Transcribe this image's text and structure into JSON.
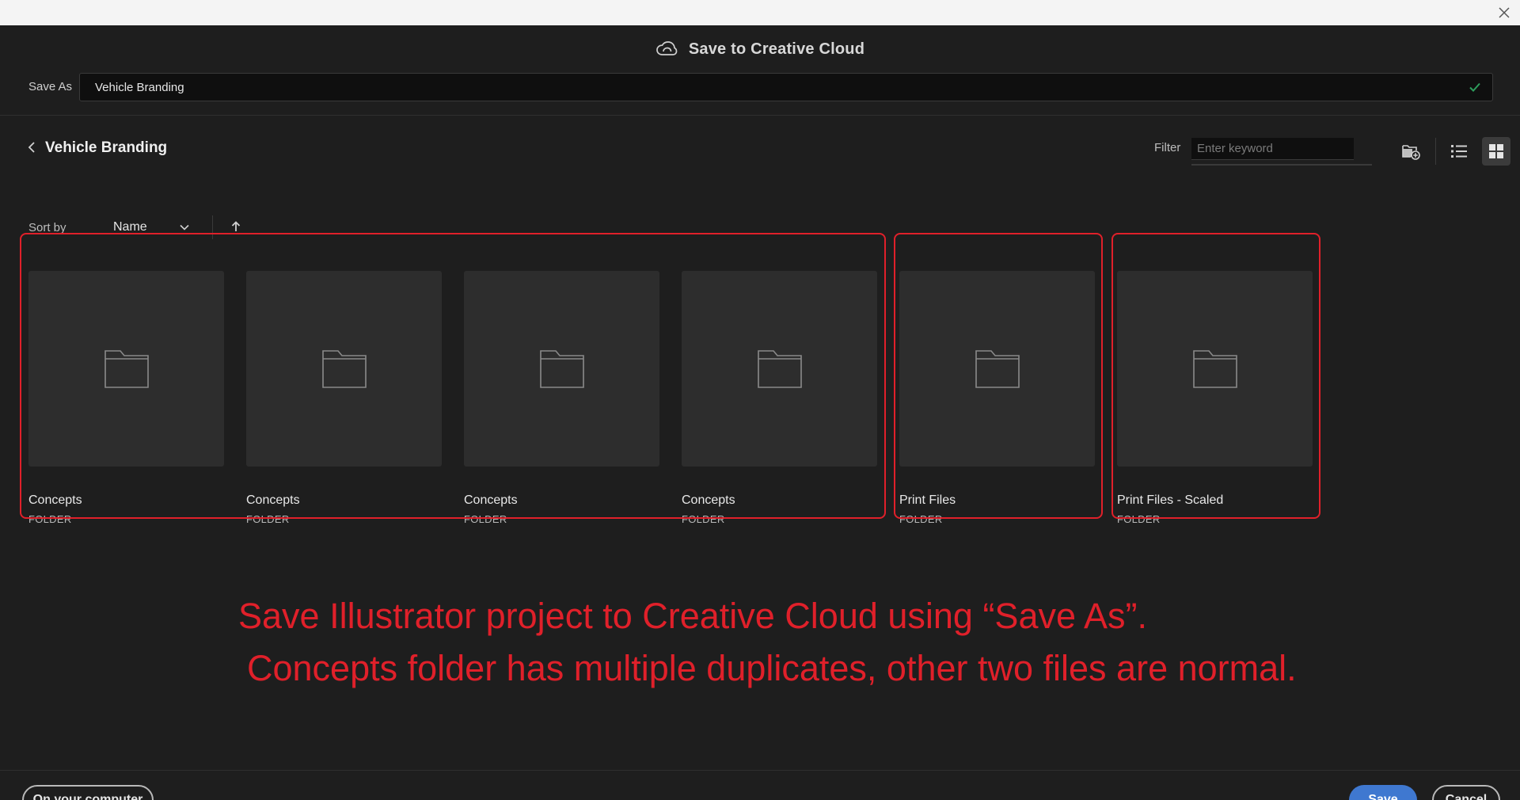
{
  "window": {
    "close_icon": "close-icon"
  },
  "dialog": {
    "title": "Save to Creative Cloud",
    "title_icon": "creative-cloud-icon"
  },
  "save_as": {
    "label": "Save As",
    "value": "Vehicle Branding",
    "valid_icon": "checkmark-icon"
  },
  "location": {
    "back_icon": "chevron-left-icon",
    "title": "Vehicle Branding"
  },
  "filter": {
    "label": "Filter",
    "placeholder": "Enter keyword"
  },
  "toolbar": {
    "new_folder_icon": "new-folder-icon",
    "list_view_icon": "list-view-icon",
    "grid_view_icon": "grid-view-icon",
    "active_view": "grid"
  },
  "sort": {
    "label": "Sort by",
    "selected": "Name",
    "direction": "ascending"
  },
  "items": [
    {
      "name": "Concepts",
      "kind": "FOLDER"
    },
    {
      "name": "Concepts",
      "kind": "FOLDER"
    },
    {
      "name": "Concepts",
      "kind": "FOLDER"
    },
    {
      "name": "Concepts",
      "kind": "FOLDER"
    },
    {
      "name": "Print Files",
      "kind": "FOLDER"
    },
    {
      "name": "Print Files - Scaled",
      "kind": "FOLDER"
    }
  ],
  "annotation": {
    "color": "#e0202a",
    "line1": "Save Illustrator project to Creative Cloud using “Save As”.",
    "line2": "Concepts folder has multiple duplicates, other two files are normal."
  },
  "footer": {
    "local_button": "On your computer",
    "save_button": "Save",
    "cancel_button": "Cancel"
  },
  "colors": {
    "background": "#1e1e1e",
    "accent": "#3f78d0",
    "highlight": "#e0202a"
  }
}
